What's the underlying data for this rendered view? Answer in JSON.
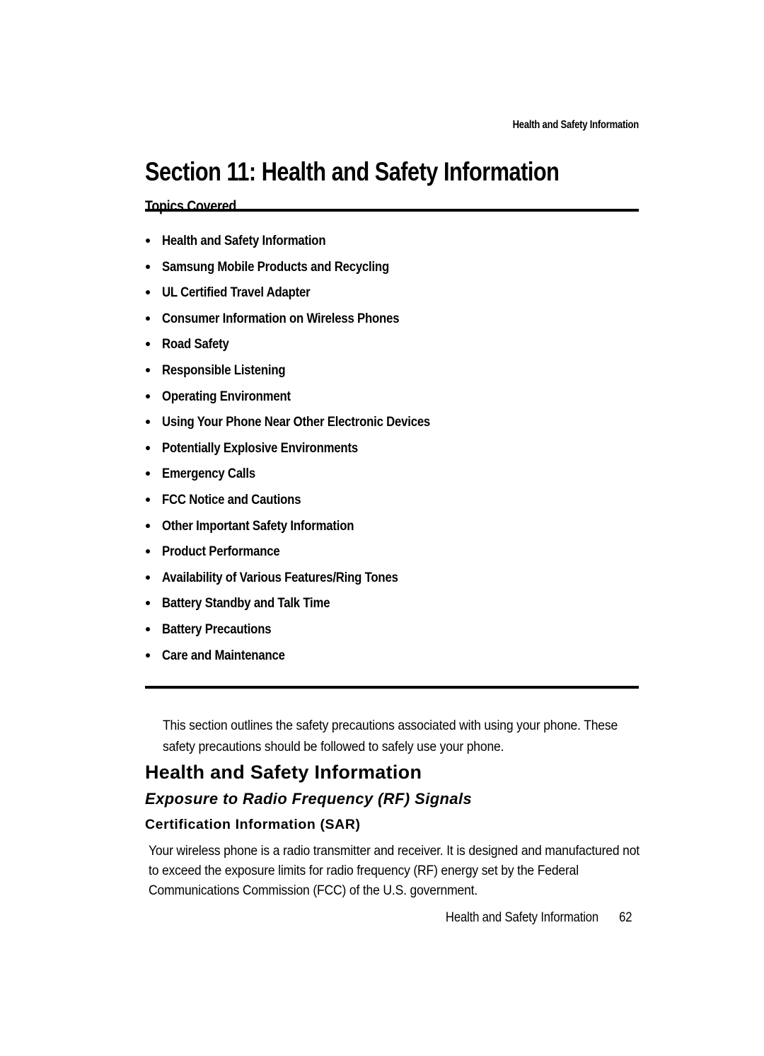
{
  "document": {
    "running_header": "Health and Safety Information",
    "section_title": "Section 11: Health and Safety Information",
    "topics_heading": "Topics Covered",
    "topics": [
      "Health and Safety Information",
      "Samsung Mobile Products and Recycling",
      "UL Certified Travel Adapter",
      "Consumer Information on Wireless Phones",
      "Road Safety",
      "Responsible Listening",
      "Operating Environment",
      "Using Your Phone Near Other Electronic Devices",
      "Potentially Explosive Environments",
      "Emergency Calls",
      "FCC Notice and Cautions",
      "Other Important Safety Information",
      "Product Performance",
      "Availability of Various Features/Ring Tones",
      "Battery Standby and Talk Time",
      "Battery Precautions",
      "Care and Maintenance"
    ],
    "intro_paragraph": "This section outlines the safety precautions associated with using your phone. These safety precautions should be followed to safely use your phone.",
    "heading_main": "Health and Safety Information",
    "heading_sub": "Exposure to Radio Frequency (RF) Signals",
    "heading_sub2": "Certification Information (SAR)",
    "body_paragraph": "Your wireless phone is a radio transmitter and receiver. It is designed and manufactured not to exceed the exposure limits for radio frequency (RF) energy set by the Federal Communications Commission (FCC) of the U.S. government.",
    "footer": {
      "label": "Health and Safety Information",
      "page_number": "62"
    },
    "colors": {
      "text": "#000000",
      "background": "#ffffff",
      "rule": "#000000"
    }
  }
}
